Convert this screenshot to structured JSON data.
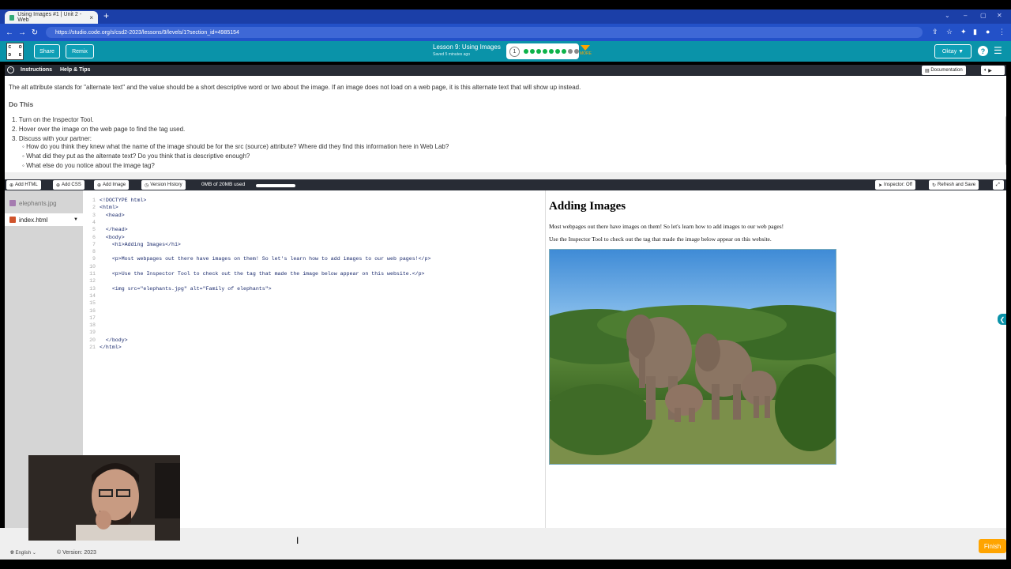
{
  "browser": {
    "tab_title": "Using Images #1 | Unit 2 - Web",
    "tab_close": "×",
    "new_tab": "+",
    "url": "https://studio.code.org/s/csd2-2023/lessons/9/levels/1?section_id=4985154"
  },
  "appbar": {
    "logo_letters": [
      "C",
      "O",
      "D",
      "E"
    ],
    "share": "Share",
    "remix": "Remix",
    "lesson_title": "Lesson 9: Using Images",
    "saved": "Saved 5 minutes ago",
    "level_number": "1",
    "progress_dots": [
      "done",
      "done",
      "done",
      "done",
      "done",
      "done",
      "done",
      "todo",
      "todo"
    ],
    "more": "MORE",
    "user": "Oktay",
    "help": "?"
  },
  "instructions": {
    "tab_instructions": "Instructions",
    "tab_help": "Help & Tips",
    "documentation": "Documentation",
    "intro": "The alt attribute stands for \"alternate text\" and the value should be a short descriptive word or two about the image. If an image does not load on a web page, it is this alternate text that will show up instead.",
    "heading": "Do This",
    "steps": [
      "1. Turn on the Inspector Tool.",
      "2. Hover over the image on the web page to find the tag used.",
      "3. Discuss with your partner:"
    ],
    "bullets": [
      "How do you think they knew what the name of the image should be for the src (source) attribute? Where did they find this information here in Web Lab?",
      "What did they put as the alternate text? Do you think that is descriptive enough?",
      "What else do you notice about the image tag?"
    ]
  },
  "toolbar": {
    "add_html": "Add HTML",
    "add_css": "Add CSS",
    "add_image": "Add Image",
    "version_history": "Version History",
    "storage": "0MB of 20MB used",
    "inspector": "Inspector: Off",
    "refresh": "Refresh and Save"
  },
  "files": [
    {
      "name": "elephants.jpg",
      "type": "image"
    },
    {
      "name": "index.html",
      "type": "html"
    }
  ],
  "editor": {
    "line_numbers": [
      "1",
      "2",
      "3",
      "4",
      "5",
      "6",
      "7",
      "8",
      "9",
      "10",
      "11",
      "12",
      "13",
      "14",
      "15",
      "16",
      "17",
      "18",
      "19",
      "20",
      "21"
    ],
    "lines": [
      "<!DOCTYPE html>",
      "<html>",
      "  <head>",
      "",
      "  </head>",
      "  <body>",
      "    <h1>Adding Images</h1>",
      "",
      "    <p>Most webpages out there have images on them! So let's learn how to add images to our web pages!</p>",
      "",
      "    <p>Use the Inspector Tool to check out the tag that made the image below appear on this website.</p>",
      "",
      "    <img src=\"elephants.jpg\" alt=\"Family of elephants\">",
      "",
      "",
      "",
      "",
      "",
      "",
      "  </body>",
      "</html>"
    ]
  },
  "preview": {
    "heading": "Adding Images",
    "para1": "Most webpages out there have images on them! So let's learn how to add images to our web pages!",
    "para2": "Use the Inspector Tool to check out the tag that made the image below appear on this website."
  },
  "footer": {
    "language": "English",
    "version": "Version: 2023",
    "finish": "Finish"
  }
}
